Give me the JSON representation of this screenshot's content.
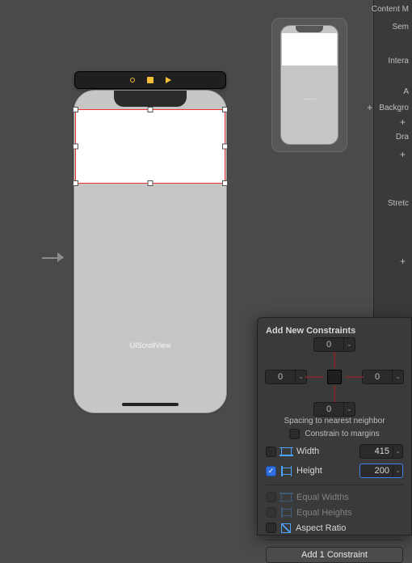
{
  "canvas": {
    "scroll_label": "UIScrollView"
  },
  "segmented": {
    "items": [
      "outline",
      "embed",
      "play"
    ]
  },
  "mini": {
    "label": "———"
  },
  "inspector": {
    "content_mode": "Content M",
    "semantic": "Sem",
    "interaction": "Intera",
    "alpha_lbl": "A",
    "background": "Backgro",
    "drawing": "Dra",
    "stretching": "Stretc"
  },
  "popover": {
    "title": "Add New Constraints",
    "top": "0",
    "left": "0",
    "right": "0",
    "bottom": "0",
    "spacing_label": "Spacing to nearest neighbor",
    "constrain_margins": "Constrain to margins",
    "width_label": "Width",
    "width_value": "415",
    "height_label": "Height",
    "height_value": "200",
    "equal_widths": "Equal Widths",
    "equal_heights": "Equal Heights",
    "aspect_ratio": "Aspect Ratio",
    "add_button": "Add 1 Constraint"
  }
}
